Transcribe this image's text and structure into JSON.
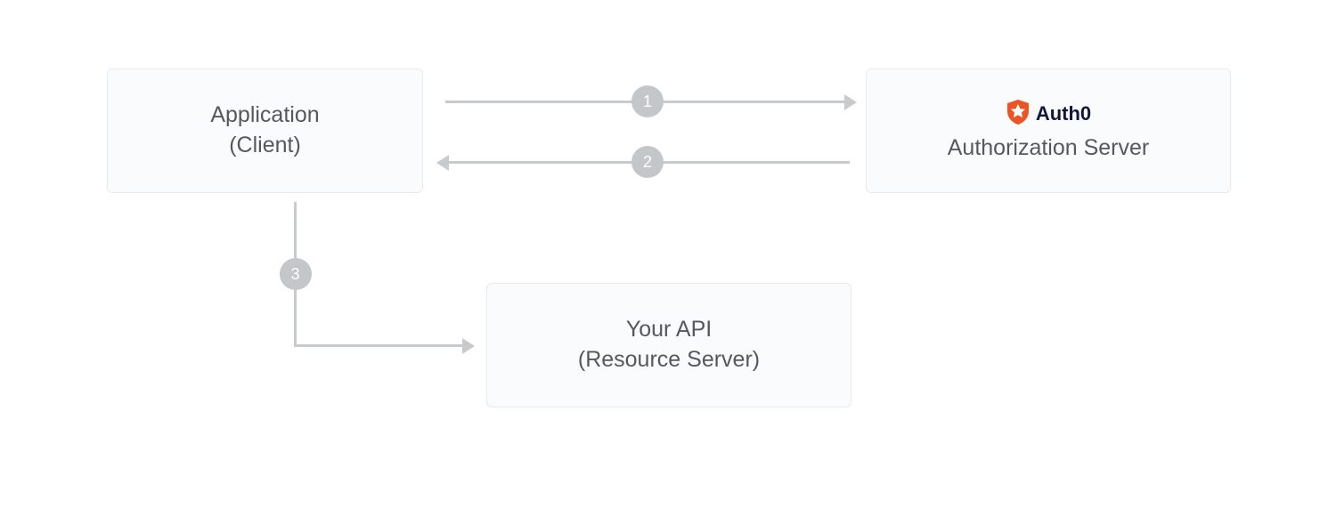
{
  "nodes": {
    "client": {
      "line1": "Application",
      "line2": "(Client)"
    },
    "authserver": {
      "logo_label": "Auth0",
      "line2": "Authorization Server"
    },
    "api": {
      "line1": "Your API",
      "line2": "(Resource Server)"
    }
  },
  "steps": {
    "s1": "1",
    "s2": "2",
    "s3": "3"
  },
  "colors": {
    "node_bg": "#fafbfc",
    "node_border": "#e8eaec",
    "arrow": "#c8cbce",
    "badge_bg": "#c4c7ca",
    "text": "#55595e",
    "logo_orange": "#eb5424",
    "logo_text": "#101739"
  }
}
